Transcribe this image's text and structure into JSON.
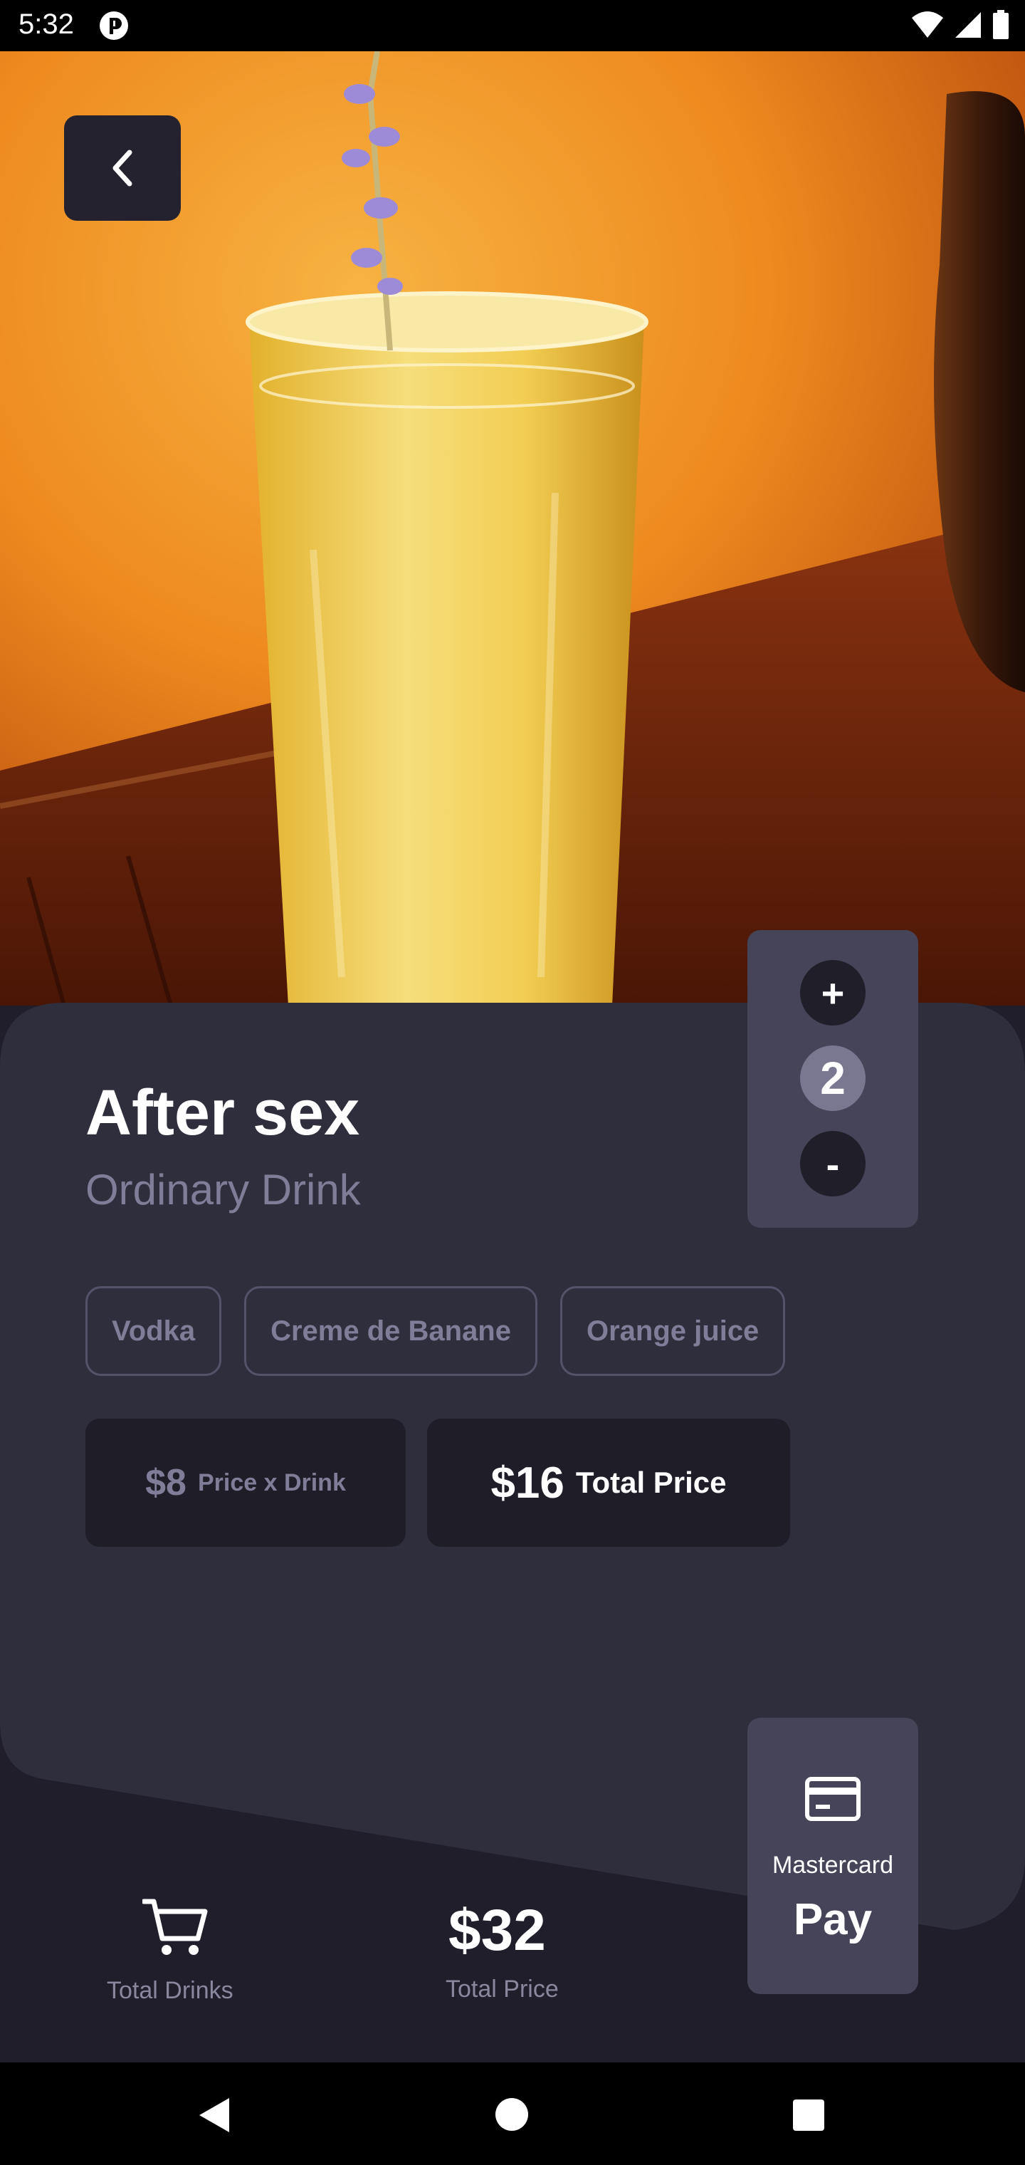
{
  "status_bar": {
    "time": "5:32",
    "icons": [
      "app-notification-icon",
      "wifi-icon",
      "signal-icon",
      "battery-icon"
    ]
  },
  "hero": {
    "image": "cocktail-photo",
    "back_icon": "chevron-left-icon"
  },
  "drink": {
    "name": "After sex",
    "category": "Ordinary Drink",
    "ingredients": [
      "Vodka",
      "Creme de Banane",
      "Orange juice"
    ]
  },
  "quantity": {
    "increase_label": "+",
    "value": "2",
    "decrease_label": "-"
  },
  "prices": {
    "unit_value": "$8",
    "unit_label": "Price x Drink",
    "total_value": "$16",
    "total_label": "Total Price"
  },
  "summary": {
    "cart_icon": "cart-icon",
    "total_drinks_label": "Total Drinks",
    "total_price_value": "$32",
    "total_price_label": "Total Price"
  },
  "payment": {
    "icon": "credit-card-icon",
    "method": "Mastercard",
    "action_label": "Pay"
  },
  "colors": {
    "background": "#1f1e2a",
    "panel": "#2f2e3c",
    "card": "#454459",
    "muted_text": "#7f7d97"
  }
}
